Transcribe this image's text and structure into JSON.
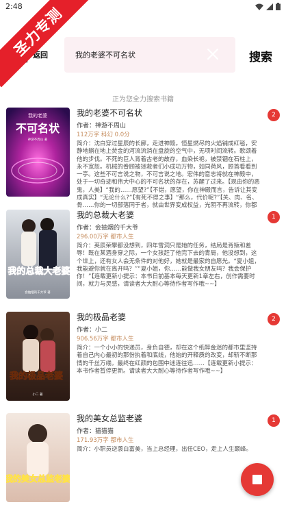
{
  "status_bar": {
    "time": "2:48"
  },
  "ribbon": {
    "text": "圣力专测"
  },
  "header": {
    "back_label": "返回",
    "search_value": "我的老婆不可名状",
    "search_button": "搜索"
  },
  "notice": "正为您全力搜索书籍",
  "books": [
    {
      "title": "我的老婆不可名状",
      "author": "作者：神游不周山",
      "meta": "112万字  科幻  0.0分",
      "desc": "简介：沈白穿过星辰的长廊，走进神殿。恒星燃尽的火焰铺成红毯，安静地躺在地上焚金的河流流淌在盘旋的空气中，无项时间流转。歌颂着他的步伐。不死的巨人背着古老的故存，血染长袍，被禁锢在石柱上，永不宽恕。机械的眷顾被拯救者们小成功万物，如同荷风，顾首看看到一亭。这些不可言说之物，不可言说之地。宏伟的意志将就在神殿中，处于一切奇迹和伟大中心的不可名状的存在，苏醒了过来。【现由你的恶鬼，人美】“我的……愿望?”【不错，愿望，你在神殿而言，告诉让其变成真实】“无论什么?”【有死不得之事】“那么，代价呢?”【关、肉、名、骨……你的一切部落同于者，就由世界变成权益，光阴不再流转，你都不能获得自由，……",
      "badge": "2",
      "cover_top_text": "我的老婆",
      "cover_title": "不可名状",
      "cover_author_line": "神游不周山 著"
    },
    {
      "title": "我的总裁大老婆",
      "author": "作者：会抽烟的千大爷",
      "meta": "296.00万字  都市人生",
      "desc": "简介：英辰荣攀都没想到，四年雪洞只是她的任务，结局是背叛和羞辱！既在某酒身穿之际，一个女孩赶了他完下去的青局，他没想到，这个世上，还有女人会无条件的对他好，她就是最家的自愿光。“夏小姐，我能避你就在离开吗？”“夏小姐，你……能做我女朋友吗？我会保护你！”【连载更新小提示：本书日前基本每天更新1章左右，创作需要时间，就力与灵感，请读者大大耐心等待作者写作哦~~】",
      "badge": "1",
      "cover_title": "我的总裁大老婆",
      "cover_author_line": "会抽烟的千大爷 著"
    },
    {
      "title": "我的极品老婆",
      "author": "作者：小二",
      "meta": "906.56万字  都市人生",
      "desc": "简介：一个小小的快递员，身负自德，却在这个纸醉金迷的都市里坚持着自己内心最初的那份执着和底线，他始的开释质的改变，却斩不断那情的千丝万缕。最终在红颜的包围中迷连往迅……【连载更新小提示：本书作者暂停更新。请读者大大耐心等待作者写作哦~~】",
      "badge": "2",
      "cover_title": "我的极品老婆",
      "cover_author_line": "小二 著"
    },
    {
      "title": "我的美女总监老婆",
      "author": "作者：猫猫猫",
      "meta": "171.93万字  都市人生",
      "desc": "简介：小职员逆袭白富美，当上总经理，出任CEO，走上人生巅峰。",
      "badge": "1",
      "cover_title": "我的美女总监老婆",
      "cover_author_line": ""
    }
  ],
  "colors": {
    "accent": "#e53935",
    "meta": "#c48a5a",
    "search_bg": "#fbf0f3"
  }
}
